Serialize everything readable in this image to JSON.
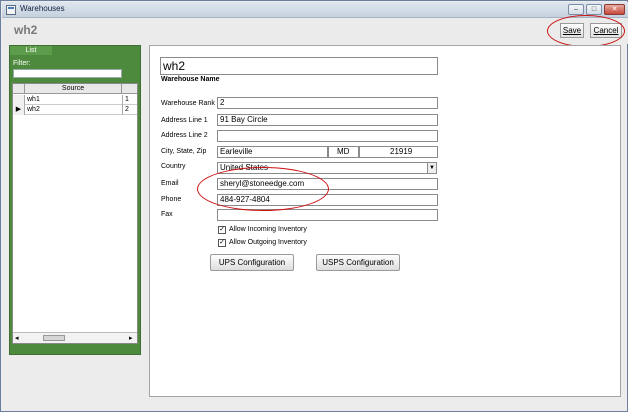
{
  "window": {
    "title": "Warehouses",
    "min_glyph": "–",
    "max_glyph": "□",
    "close_glyph": "✕"
  },
  "header": {
    "record_title": "wh2",
    "save_label": "Save",
    "cancel_label": "Cancel"
  },
  "list_panel": {
    "tab_label": "List",
    "filter_label": "Filter:",
    "filter_value": "",
    "column_header": "Source",
    "rows": [
      {
        "name": "wh1",
        "value": "1",
        "selector": ""
      },
      {
        "name": "wh2",
        "value": "2",
        "selector": "▶"
      }
    ],
    "scroll_left": "◂",
    "scroll_right": "▸"
  },
  "detail": {
    "warehouse_name_value": "wh2",
    "warehouse_name_label": "Warehouse Name",
    "rank_label": "Warehouse Rank",
    "rank_value": "2",
    "address1_label": "Address Line 1",
    "address1_value": "91 Bay Circle",
    "address2_label": "Address Line 2",
    "address2_value": "",
    "city_state_zip_label": "City, State, Zip",
    "city_value": "Earleville",
    "state_value": "MD",
    "zip_value": "21919",
    "country_label": "Country",
    "country_value": "United States",
    "country_arrow": "▼",
    "email_label": "Email",
    "email_value": "sheryl@stoneedge.com",
    "phone_label": "Phone",
    "phone_value": "484-927-4804",
    "fax_label": "Fax",
    "fax_value": "",
    "allow_incoming_label": "Allow Incoming Inventory",
    "allow_incoming_checked": "✓",
    "allow_outgoing_label": "Allow Outgoing Inventory",
    "allow_outgoing_checked": "✓",
    "ups_button_label": "UPS Configuration",
    "usps_button_label": "USPS Configuration"
  },
  "colors": {
    "list_panel_green": "#4e8a3e",
    "annotation_red": "#cc1111"
  }
}
